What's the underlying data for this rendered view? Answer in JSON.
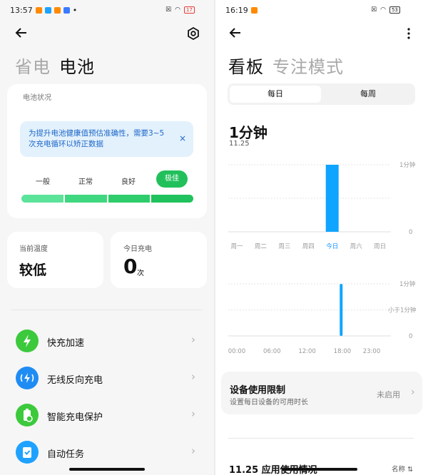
{
  "left": {
    "status_time": "13:57",
    "status_dot": "•",
    "battery_level": "17",
    "status_colors": [
      "#ff8a00",
      "#1fa2ff",
      "#ff8a00",
      "#3a7bff"
    ],
    "back_icon": "arrow-left-icon",
    "settings_icon": "gear-icon",
    "tabs": [
      {
        "label": "省电",
        "active": false
      },
      {
        "label": "电池",
        "active": true
      }
    ],
    "battery_status": {
      "label": "电池状况",
      "notice": "为提升电池健康值预估准确性，需要3~5次充电循环以矫正数据",
      "close_glyph": "×",
      "levels": [
        "一般",
        "正常",
        "良好",
        "极佳"
      ],
      "selected_level": "极佳",
      "segment_colors": [
        "#5be39a",
        "#3fd77f",
        "#2ecc6b",
        "#1fc25c"
      ],
      "accent": "#22c05b"
    },
    "temperature": {
      "label": "当前温度",
      "value": "较低"
    },
    "charge_today": {
      "label": "今日充电",
      "value": "0",
      "unit": "次"
    },
    "menu": [
      {
        "label": "快充加速",
        "icon": "lightning-icon",
        "glyph": "⚡",
        "color": "#3cc93c"
      },
      {
        "label": "无线反向充电",
        "icon": "wireless-charge-icon",
        "glyph": "((ϟ))",
        "color": "#1f8cf3"
      },
      {
        "label": "智能充电保护",
        "icon": "battery-shield-icon",
        "glyph": "▮",
        "color": "#3cc93c"
      },
      {
        "label": "自动任务",
        "icon": "clipboard-check-icon",
        "glyph": "✓",
        "color": "#1fa2ff"
      }
    ],
    "chevron": "›"
  },
  "right": {
    "status_time": "16:19",
    "battery_level": "53",
    "back_icon": "arrow-left-icon",
    "more_icon": "more-vertical-icon",
    "tabs": [
      {
        "label": "看板",
        "active": true
      },
      {
        "label": "专注模式",
        "active": false
      }
    ],
    "segment": {
      "options": [
        "每日",
        "每周"
      ],
      "selected": "每日"
    },
    "total_time": "1分钟",
    "date": "11.25",
    "limit": {
      "title": "设备使用限制",
      "subtitle": "设置每日设备的可用时长",
      "status": "未启用",
      "chevron": "›"
    },
    "usage_title": "11.25 应用使用情况",
    "sort_label": "名称 ⇅"
  },
  "chart_data": [
    {
      "type": "bar",
      "categories": [
        "周一",
        "周二",
        "周三",
        "周四",
        "今日",
        "周六",
        "周日"
      ],
      "values": [
        0,
        0,
        0,
        0,
        1,
        0,
        0
      ],
      "unit": "分钟",
      "y_tick_labels": [
        "0",
        "1分钟"
      ],
      "ylim": [
        0,
        1
      ],
      "highlight": "今日",
      "bar_color": "#0fa4ff"
    },
    {
      "type": "bar",
      "x_tick_labels": [
        "00:00",
        "06:00",
        "12:00",
        "18:00",
        "23:00"
      ],
      "x_hours": [
        0,
        6,
        12,
        18,
        23
      ],
      "bars": [
        {
          "hour": 17.8,
          "value": 1
        }
      ],
      "y_tick_labels": [
        "0",
        "小于1分钟",
        "1分钟"
      ],
      "ylim": [
        0,
        1
      ],
      "bar_color": "#0fa4ff"
    }
  ]
}
